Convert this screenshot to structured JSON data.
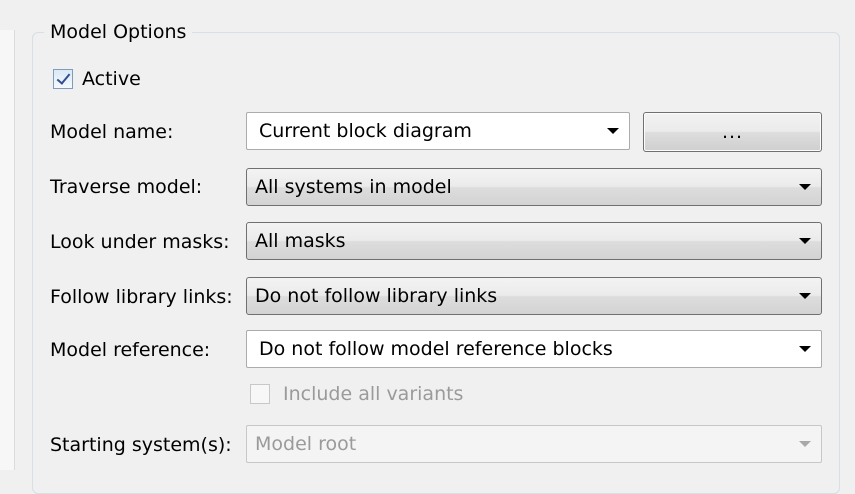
{
  "group": {
    "title": "Model Options"
  },
  "active": {
    "label": "Active",
    "checked": true
  },
  "model_name": {
    "label": "Model name:",
    "value": "Current block diagram",
    "browse_label": "..."
  },
  "traverse_model": {
    "label": "Traverse model:",
    "value": "All systems in model"
  },
  "look_under_masks": {
    "label": "Look under masks:",
    "value": "All masks"
  },
  "follow_library_links": {
    "label": "Follow library links:",
    "value": "Do not follow library links"
  },
  "model_reference": {
    "label": "Model reference:",
    "value": "Do not follow model reference blocks"
  },
  "include_all_variants": {
    "label": "Include all variants",
    "checked": false,
    "enabled": false
  },
  "starting_systems": {
    "label": "Starting system(s):",
    "value": "Model root",
    "enabled": false
  },
  "icons": {
    "dropdown": "chevron-down-icon",
    "check": "checkmark-icon"
  },
  "colors": {
    "disabled_text": "#9a9a9a",
    "group_border": "#d5dfe5",
    "check_mark": "#2f4f8f"
  }
}
